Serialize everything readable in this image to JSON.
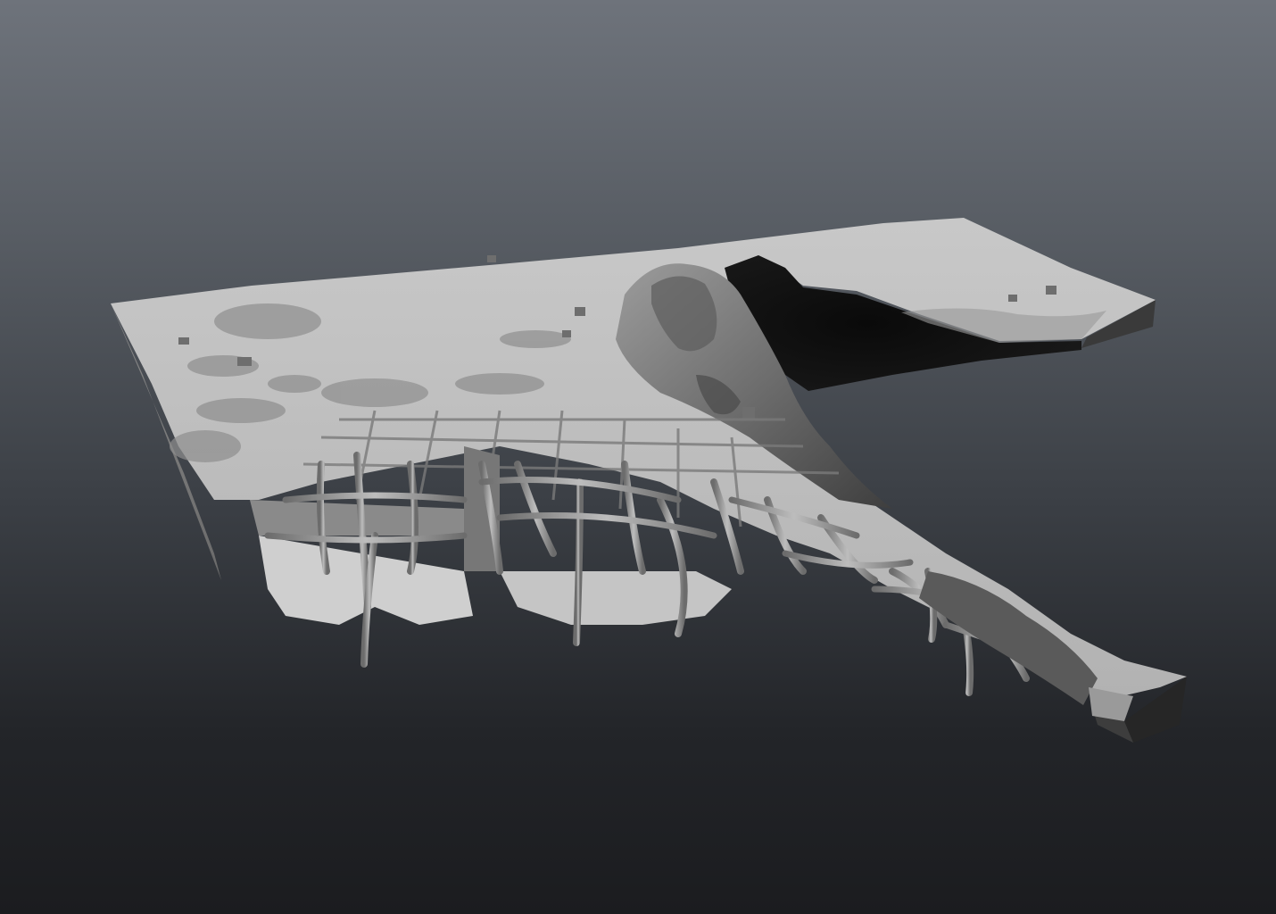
{
  "viewport": {
    "background_top_color": "#6e737b",
    "background_bottom_color": "#1b1c1f"
  },
  "model": {
    "shading": "clay-grey",
    "base_color": "#b9b9b9"
  }
}
